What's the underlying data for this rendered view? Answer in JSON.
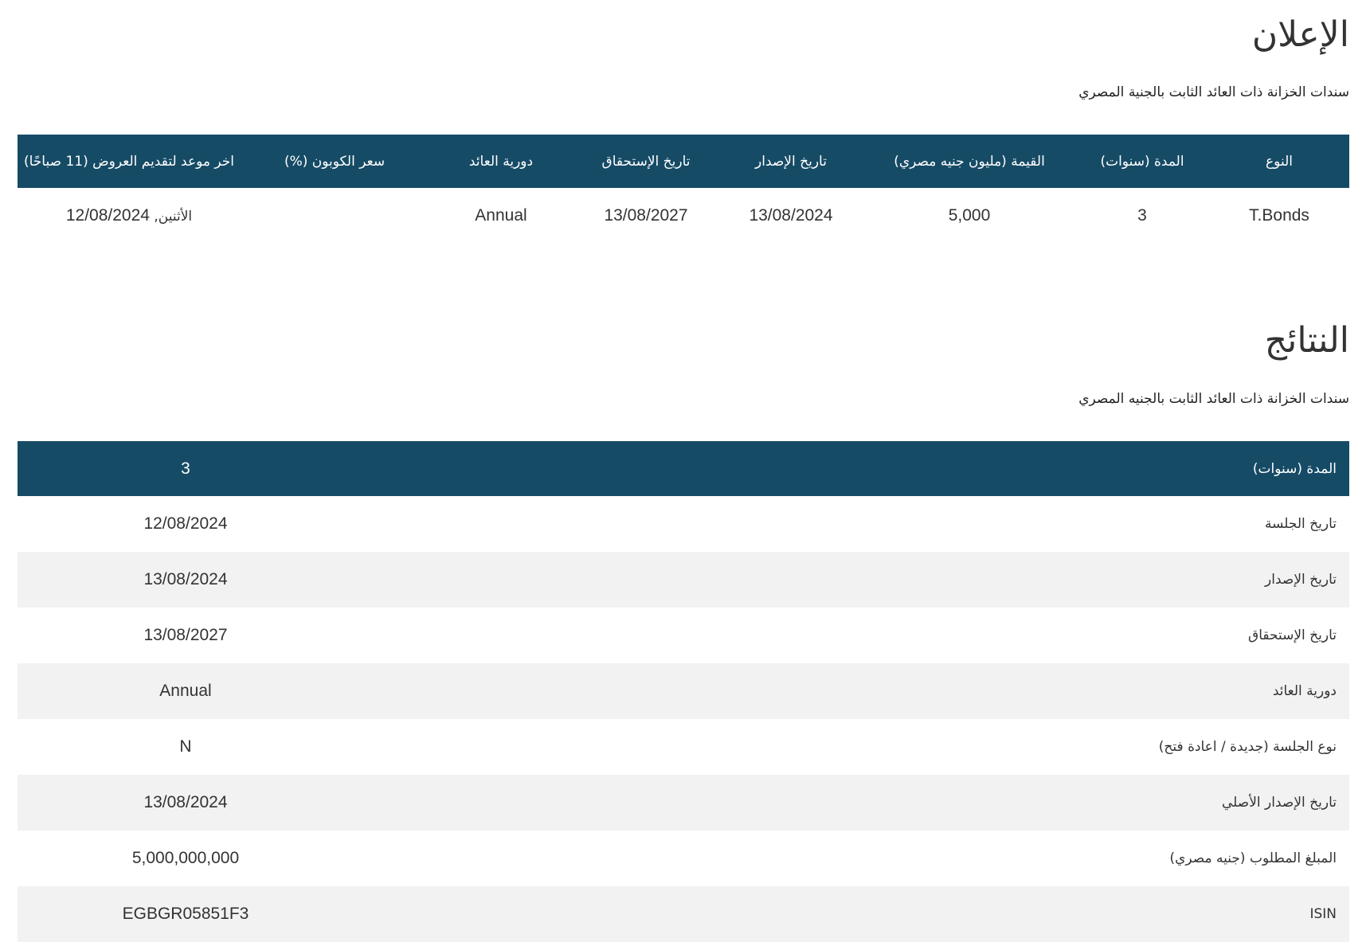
{
  "announcement": {
    "title": "الإعلان",
    "subtitle": "سندات الخزانة ذات العائد الثابت بالجنية المصري",
    "columns": [
      "النوع",
      "المدة (سنوات)",
      "القيمة (مليون جنيه مصري)",
      "تاريخ الإصدار",
      "تاريخ الإستحقاق",
      "دورية العائد",
      "سعر الكوبون (%)",
      "اخر موعد لتقديم العروض (11 صباحًا)"
    ],
    "row": {
      "type": "T.Bonds",
      "tenor": "3",
      "amount": "5,000",
      "issue_date": "13/08/2024",
      "maturity_date": "13/08/2027",
      "frequency": "Annual",
      "coupon": "",
      "deadline_day": "الأثنين,",
      "deadline_date": "12/08/2024"
    }
  },
  "results": {
    "title": "النتائج",
    "subtitle": "سندات الخزانة ذات العائد الثابت بالجنيه المصري",
    "header": {
      "label": "المدة (سنوات)",
      "value": "3"
    },
    "rows": [
      {
        "label": "تاريخ الجلسة",
        "value": "12/08/2024"
      },
      {
        "label": "تاريخ الإصدار",
        "value": "13/08/2024"
      },
      {
        "label": "تاريخ الإستحقاق",
        "value": "13/08/2027"
      },
      {
        "label": "دورية العائد",
        "value": "Annual"
      },
      {
        "label": "نوع الجلسة (جديدة / اعادة فتح)",
        "value": "N"
      },
      {
        "label": "تاريخ الإصدار الأصلي",
        "value": "13/08/2024"
      },
      {
        "label": "المبلغ المطلوب (جنيه مصري)",
        "value": "5,000,000,000"
      },
      {
        "label": "ISIN",
        "value": "EGBGR05851F3"
      }
    ]
  },
  "colors": {
    "header_bg": "#164b66",
    "header_text": "#ffffff",
    "alt_row_bg": "#f2f2f2",
    "text": "#333333"
  }
}
